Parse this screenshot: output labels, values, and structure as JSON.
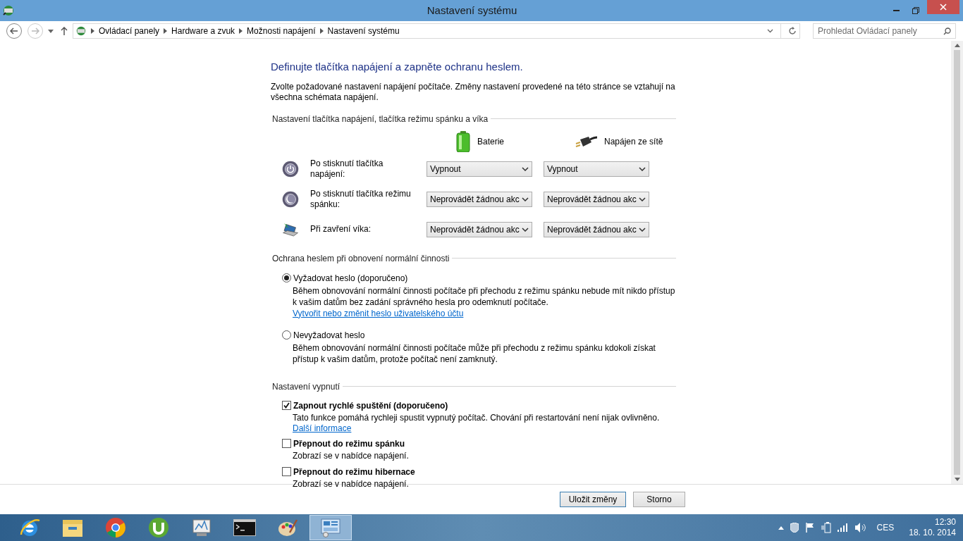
{
  "window": {
    "title": "Nastavení systému"
  },
  "nav": {
    "breadcrumb": [
      "Ovládací panely",
      "Hardware a zvuk",
      "Možnosti napájení",
      "Nastavení systému"
    ],
    "search_placeholder": "Prohledat Ovládací panely"
  },
  "page": {
    "heading": "Definujte tlačítka napájení a zapněte ochranu heslem.",
    "description": "Zvolte požadované nastavení napájení počítače. Změny nastavení provedené na této stránce se vztahují na všechna schémata napájení."
  },
  "power_section": {
    "title": "Nastavení tlačítka napájení, tlačítka režimu spánku a víka",
    "columns": [
      {
        "kind": "battery",
        "label": "Baterie"
      },
      {
        "kind": "plug",
        "label": "Napájen ze sítě"
      }
    ],
    "rows": [
      {
        "kind": "power",
        "label": "Po stisknutí tlačítka napájení:",
        "battery": "Vypnout",
        "ac": "Vypnout"
      },
      {
        "kind": "sleep",
        "label": "Po stisknutí tlačítka režimu spánku:",
        "battery": "Neprovádět žádnou akc",
        "ac": "Neprovádět žádnou akc"
      },
      {
        "kind": "lid",
        "label": "Při zavření víka:",
        "battery": "Neprovádět žádnou akc",
        "ac": "Neprovádět žádnou akc"
      }
    ]
  },
  "password_section": {
    "title": "Ochrana heslem při obnovení normální činnosti",
    "options": [
      {
        "label": "Vyžadovat heslo (doporučeno)",
        "selected": true,
        "description": "Během obnovování normální činnosti počítače při přechodu z režimu spánku nebude mít nikdo přístup k vašim datům bez zadání správného hesla pro odemknutí počítače.",
        "link": "Vytvořit nebo změnit heslo uživatelského účtu"
      },
      {
        "label": "Nevyžadovat heslo",
        "selected": false,
        "description": "Během obnovování normální činnosti počítače může při přechodu z režimu spánku kdokoli získat přístup k vašim datům, protože počítač není zamknutý."
      }
    ]
  },
  "shutdown_section": {
    "title": "Nastavení vypnutí",
    "options": [
      {
        "label": "Zapnout rychlé spuštění (doporučeno)",
        "checked": true,
        "description": "Tato funkce pomáhá rychleji spustit vypnutý počítač. Chování při restartování není nijak ovlivněno.",
        "link": "Další informace"
      },
      {
        "label": "Přepnout do režimu spánku",
        "checked": false,
        "description": "Zobrazí se v nabídce napájení."
      },
      {
        "label": "Přepnout do režimu hibernace",
        "checked": false,
        "description": "Zobrazí se v nabídce napájení."
      }
    ]
  },
  "buttons": [
    {
      "label": "Uložit změny",
      "kind": "primary"
    },
    {
      "label": "Storno",
      "kind": "normal"
    }
  ],
  "taskbar": {
    "apps": [
      {
        "kind": "ie",
        "selected": false
      },
      {
        "kind": "explorer",
        "selected": false
      },
      {
        "kind": "chrome",
        "selected": false
      },
      {
        "kind": "torrent",
        "selected": false
      },
      {
        "kind": "monitor",
        "selected": false
      },
      {
        "kind": "console",
        "selected": false
      },
      {
        "kind": "paint",
        "selected": false
      },
      {
        "kind": "control",
        "selected": true
      }
    ],
    "language": "CES",
    "time": "12:30",
    "date": "18. 10. 2014"
  }
}
